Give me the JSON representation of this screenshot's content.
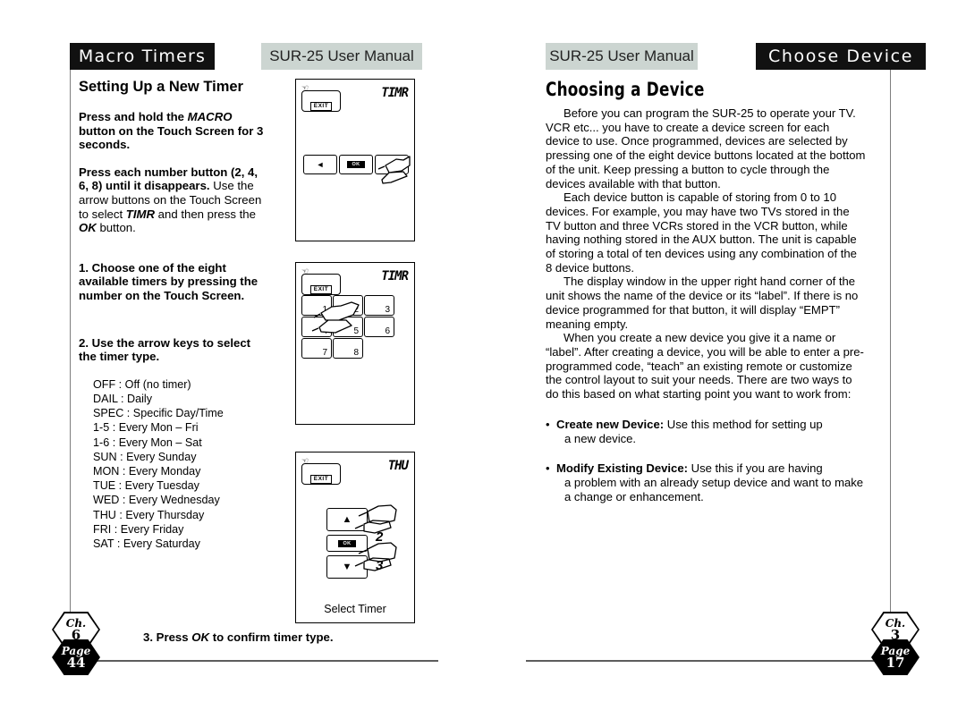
{
  "left_page": {
    "header_title": "Macro Timers",
    "header_manual": "SUR-25 User Manual",
    "section_title": "Setting Up a New Timer",
    "para1": "Press and hold the MACRO button on the Touch Screen for 3 seconds.",
    "para1_parts": {
      "a": "Press and hold the ",
      "em": "MACRO",
      "b": " button on the Touch Screen for 3 seconds."
    },
    "para2_bold": "Press each number button (2, 4, 6, 8) until it disappears.",
    "para2_rest": " Use the arrow buttons on the Touch Screen to select ",
    "para2_em": "TIMR",
    "para2_rest2": " and then press  the ",
    "para2_em2": "OK",
    "para2_rest3": " button.",
    "step1": "1. Choose one of the eight available timers by pressing the number on the Touch Screen.",
    "step2": "2. Use the arrow keys to select the timer type.",
    "step3_a": "3. Press ",
    "step3_em": "OK",
    "step3_b": " to confirm timer type.",
    "timer_types": [
      "OFF : Off (no timer)",
      "DAIL : Daily",
      "SPEC : Specific Day/Time",
      "1-5 : Every Mon – Fri",
      "1-6 : Every Mon – Sat",
      "SUN : Every Sunday",
      "MON : Every Monday",
      "TUE : Every Tuesday",
      "WED : Every Wednesday",
      "THU : Every Thursday",
      "FRI : Every Friday",
      "SAT : Every Saturday"
    ],
    "badge": {
      "ch_label": "Ch.",
      "ch_num": "6",
      "page_label": "Page",
      "page_num": "44"
    }
  },
  "screens": {
    "screen1": {
      "lcd": "TIMR",
      "exit": "EXIT",
      "buttons": [
        "◄",
        "OK",
        "►"
      ]
    },
    "screen2": {
      "lcd": "TIMR",
      "exit": "EXIT",
      "keys": [
        "1",
        "2",
        "3",
        "4",
        "5",
        "6",
        "7",
        "8"
      ],
      "hand_label": "1"
    },
    "screen3": {
      "lcd": "THU",
      "exit": "EXIT",
      "up": "▲",
      "ok": "OK",
      "down": "▼",
      "hand_label_up": "2",
      "hand_label_down": "3",
      "caption": "Select Timer"
    }
  },
  "right_page": {
    "header_manual": "SUR-25 User Manual",
    "header_title": "Choose  Device",
    "section_title": "Choosing a Device",
    "para1": "Before you can program the SUR-25 to operate your TV. VCR etc... you have to create a device screen for each device to use. Once programmed, devices are selected by pressing one of the eight device buttons located at the bottom of the unit. Keep pressing a button to cycle through the devices available with that button.",
    "para2": "Each device button is capable of storing from 0 to 10 devices. For example, you may have two TVs stored in the TV button and three VCRs stored in the VCR button, while having nothing stored in the AUX button. The unit is capable of storing a total of ten devices using any combination of the 8 device buttons.",
    "para3": "The display window in the upper right hand corner of the unit shows the name of the device or its “label”. If there is no device programmed for that button, it will display “EMPT” meaning empty.",
    "para4": "When you create a new device you give it a name or “label”. After creating a device, you will be able to enter a pre-programmed code, “teach” an existing remote or customize the control layout to suit your needs. There are two ways to do this based on what starting point you want to work from:",
    "bullet1_title": "Create new Device:",
    "bullet1_text": " Use this method for setting up",
    "bullet1_cont": "a new device.",
    "bullet2_title": "Modify Existing Device:",
    "bullet2_text": " Use this if you are having",
    "bullet2_cont": "a problem with an already setup device and want to make a change or enhancement.",
    "bullet_dot": "•",
    "badge": {
      "ch_label": "Ch.",
      "ch_num": "3",
      "page_label": "Page",
      "page_num": "17"
    }
  },
  "colors": {
    "header_black": "#111111",
    "header_gray": "#ccd5d1",
    "rule": "#5d5d5d"
  }
}
